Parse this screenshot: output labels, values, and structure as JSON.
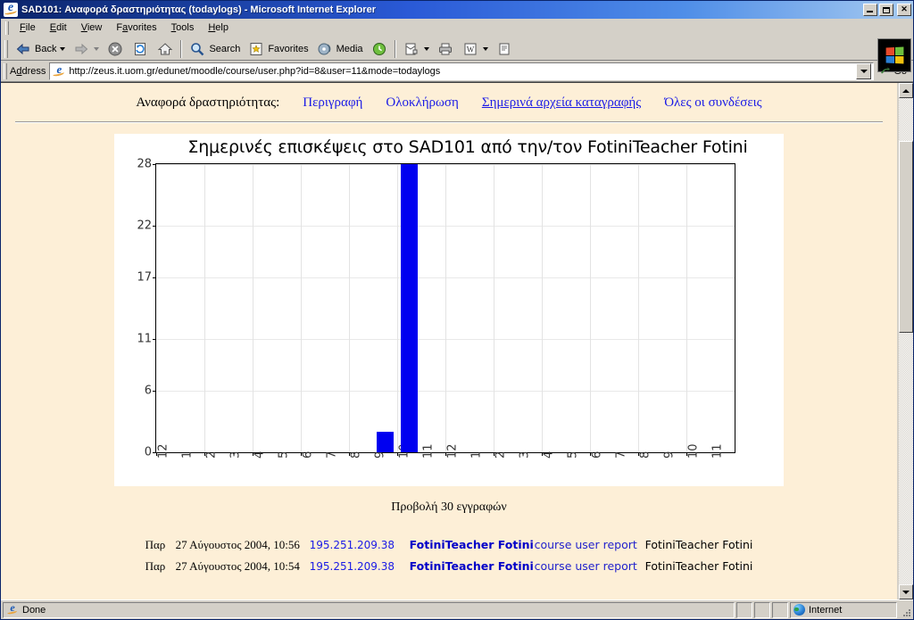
{
  "window": {
    "title": "SAD101: Αναφορά δραστηριότητας (todaylogs) - Microsoft Internet Explorer",
    "minimize_label": "_",
    "maximize_label": "□",
    "close_label": "✕"
  },
  "menubar": {
    "items": [
      {
        "name": "file",
        "pre": "F",
        "accel": "i",
        "post": "le"
      },
      {
        "name": "edit",
        "pre": "E",
        "accel": "d",
        "post": "it"
      },
      {
        "name": "view",
        "pre": "",
        "accel": "V",
        "post": "iew"
      },
      {
        "name": "favorites",
        "pre": "F",
        "accel": "a",
        "post": "vorites"
      },
      {
        "name": "tools",
        "pre": "",
        "accel": "T",
        "post": "ools"
      },
      {
        "name": "help",
        "pre": "",
        "accel": "H",
        "post": "elp"
      }
    ]
  },
  "toolbar": {
    "back_label": "Back",
    "forward_label": "",
    "stop_label": "",
    "refresh_label": "",
    "home_label": "",
    "search_label": "Search",
    "favorites_label": "Favorites",
    "media_label": "Media",
    "history_label": "",
    "mail_label": "",
    "print_label": "",
    "edit_label": "",
    "discuss_label": ""
  },
  "address": {
    "label": "Address",
    "url": "http://zeus.it.uom.gr/edunet/moodle/course/user.php?id=8&user=11&mode=todaylogs",
    "go_label": "Go"
  },
  "page": {
    "nav": {
      "label": "Αναφορά δραστηριότητας:",
      "links": [
        {
          "name": "outline",
          "text": "Περιγραφή",
          "current": false
        },
        {
          "name": "complete",
          "text": "Ολοκλήρωση",
          "current": false
        },
        {
          "name": "todaylogs",
          "text": "Σημερινά αρχεία καταγραφής",
          "current": true
        },
        {
          "name": "alllogs",
          "text": "Όλες οι συνδέσεις",
          "current": false
        }
      ]
    },
    "records_count": "Προβολή 30 εγγραφών",
    "logs": [
      {
        "day": "Παρ",
        "date": "27 Αύγουστος 2004, 10:56",
        "ip": "195.251.209.38",
        "user": "FotiniTeacher Fotini",
        "action": "course user report",
        "info": "FotiniTeacher Fotini"
      },
      {
        "day": "Παρ",
        "date": "27 Αύγουστος 2004, 10:54",
        "ip": "195.251.209.38",
        "user": "FotiniTeacher Fotini",
        "action": "course user report",
        "info": "FotiniTeacher Fotini"
      }
    ]
  },
  "chart_data": {
    "type": "bar",
    "title": "Σημερινές επισκέψεις στο SAD101 από την/τον FotiniTeacher Fotini",
    "xlabel": "",
    "ylabel": "",
    "categories": [
      "12",
      "1",
      "2",
      "3",
      "4",
      "5",
      "6",
      "7",
      "8",
      "9",
      "10",
      "11",
      "12",
      "1",
      "2",
      "3",
      "4",
      "5",
      "6",
      "7",
      "8",
      "9",
      "10",
      "11"
    ],
    "values": [
      0,
      0,
      0,
      0,
      0,
      0,
      0,
      0,
      0,
      2,
      28,
      0,
      0,
      0,
      0,
      0,
      0,
      0,
      0,
      0,
      0,
      0,
      0,
      0
    ],
    "yticks": [
      0,
      6,
      11,
      17,
      22,
      28
    ],
    "ylim": [
      0,
      28
    ],
    "bar_color": "#0000f0",
    "grid": true,
    "legend": false
  },
  "statusbar": {
    "status": "Done",
    "zone": "Internet"
  }
}
